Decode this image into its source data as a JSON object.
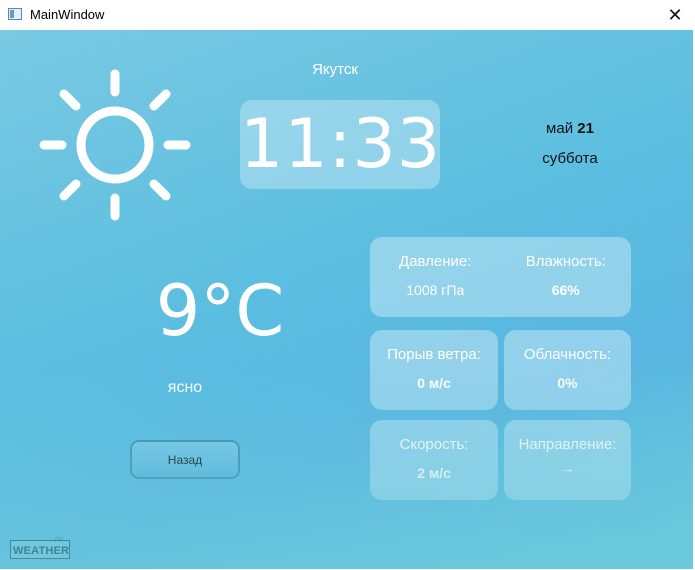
{
  "window": {
    "title": "MainWindow",
    "close_label": "✕"
  },
  "weather": {
    "city": "Якутск",
    "time": "11:33",
    "date_month": "май",
    "date_day": "21",
    "weekday": "суббота",
    "temperature": "9°C",
    "condition": "ясно",
    "condition_icon": "sun-icon"
  },
  "buttons": {
    "back_label": "Назад"
  },
  "stats": {
    "pressure": {
      "label": "Давление:",
      "value": "1008 гПа"
    },
    "humidity": {
      "label": "Влажность:",
      "value": "66%"
    },
    "gust": {
      "label": "Порыв ветра:",
      "value": "0 м/с"
    },
    "clouds": {
      "label": "Облачность:",
      "value": "0%"
    },
    "speed": {
      "label": "Скорость:",
      "value": "2 м/с"
    },
    "direction": {
      "label": "Направление:",
      "value": "→"
    }
  },
  "logo": {
    "top": "PY",
    "text": "WEATHER"
  },
  "colors": {
    "background_top": "#79c9e2",
    "background_bottom": "#58b6e0",
    "text_light": "#ffffff",
    "button_border": "#3d8db3"
  }
}
